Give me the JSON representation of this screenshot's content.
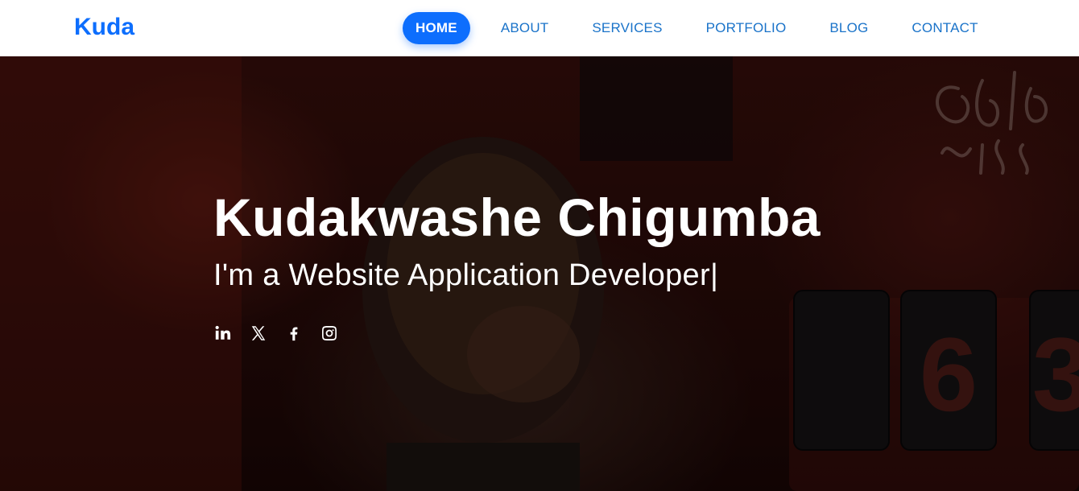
{
  "brand": {
    "name": "Kuda",
    "color": "#0d6efd"
  },
  "nav": {
    "items": [
      {
        "label": "HOME",
        "active": true
      },
      {
        "label": "ABOUT",
        "active": false
      },
      {
        "label": "SERVICES",
        "active": false
      },
      {
        "label": "PORTFOLIO",
        "active": false
      },
      {
        "label": "BLOG",
        "active": false
      },
      {
        "label": "CONTACT",
        "active": false
      }
    ],
    "link_color": "#1a73c9",
    "active_bg": "#0d6efd"
  },
  "hero": {
    "name": "Kudakwashe Chigumba",
    "subtitle_prefix": "I'm a ",
    "subtitle_role": "Website Application Developer",
    "cursor": "|",
    "social": [
      {
        "icon": "linkedin-icon"
      },
      {
        "icon": "x-twitter-icon"
      },
      {
        "icon": "facebook-icon"
      },
      {
        "icon": "instagram-icon"
      }
    ],
    "background_digits": [
      "6",
      "3"
    ]
  }
}
